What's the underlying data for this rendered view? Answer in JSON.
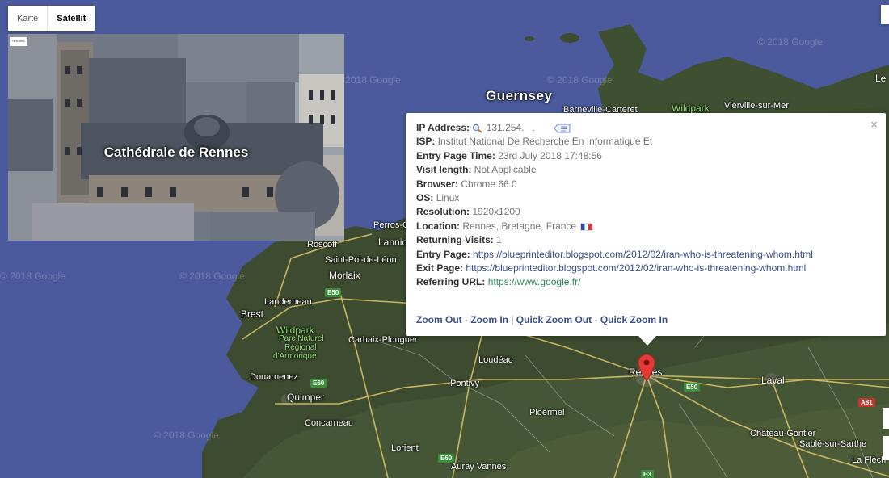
{
  "map": {
    "type_control": {
      "map_label": "Karte",
      "satellite_label": "Satellit"
    },
    "watermark": "© 2018 Google",
    "places": {
      "guernsey": "Guernsey",
      "barneville": "Barneville-Carteret",
      "vierville": "Vierville-sur-Mer",
      "le": "Le",
      "wildpark_north": "Wildpark",
      "perros": "Perros-G",
      "lannion": "Lannio",
      "roscoff": "Roscoff",
      "saint_pol": "Saint-Pol-de-Léon",
      "morlaix": "Morlaix",
      "landerneau": "Landerneau",
      "brest": "Brest",
      "wildpark_west": "Wildpark",
      "park_naturel": "Parc Naturel",
      "regional": "Régional",
      "armorique": "d'Armorique",
      "carhaix": "Carhaix-Plouguer",
      "loudeac": "Loudéac",
      "douarnenez": "Douarnenez",
      "quimper": "Quimper",
      "concarneau": "Concarneau",
      "pontivy": "Pontivy",
      "ploermel": "Ploërmel",
      "lorient": "Lorient",
      "auray_vannes": "Auray Vannes",
      "rennes": "Rennes",
      "laval": "Laval",
      "chateau_gontier": "Château-Gontier",
      "sable": "Sablé-sur-Sarthe",
      "la_fleche": "La Flèch"
    },
    "roads": {
      "e50_west": "E50",
      "e60_west": "E60",
      "e60_south": "E60",
      "e50_east": "E50",
      "a81": "A81",
      "e3": "E3"
    }
  },
  "photo": {
    "caption": "Cathédrale de Rennes",
    "mini_label": "rennes"
  },
  "info": {
    "close_glyph": "×",
    "ip_label": "IP Address:",
    "ip_value": "131.254.   .",
    "isp_label": "ISP:",
    "isp_value": "Institut National De Recherche En Informatique Et",
    "entry_time_label": "Entry Page Time:",
    "entry_time_value": "23rd July 2018 17:48:56",
    "visit_length_label": "Visit length:",
    "visit_length_value": "Not Applicable",
    "browser_label": "Browser:",
    "browser_value": "Chrome 66.0",
    "os_label": "OS:",
    "os_value": "Linux",
    "resolution_label": "Resolution:",
    "resolution_value": "1920x1200",
    "location_label": "Location:",
    "location_value": "Rennes, Bretagne, France",
    "returning_label": "Returning Visits:",
    "returning_value": "1",
    "entry_page_label": "Entry Page:",
    "entry_page_value": "https://blueprinteditor.blogspot.com/2012/02/iran-who-is-threatening-whom.html",
    "exit_page_label": "Exit Page:",
    "exit_page_value": "https://blueprinteditor.blogspot.com/2012/02/iran-who-is-threatening-whom.html",
    "referring_label": "Referring URL:",
    "referring_value": "https://www.google.fr/",
    "zoom": {
      "zoom_out": "Zoom Out",
      "sep1": " - ",
      "zoom_in": "Zoom In",
      "sep2": " | ",
      "quick_out": "Quick Zoom Out",
      "sep3": " - ",
      "quick_in": "Quick Zoom In"
    }
  },
  "colors": {
    "sea": "#4a5a9c",
    "land": "#3f4f34",
    "link": "#3a4e8c",
    "marker": "#e53935"
  }
}
